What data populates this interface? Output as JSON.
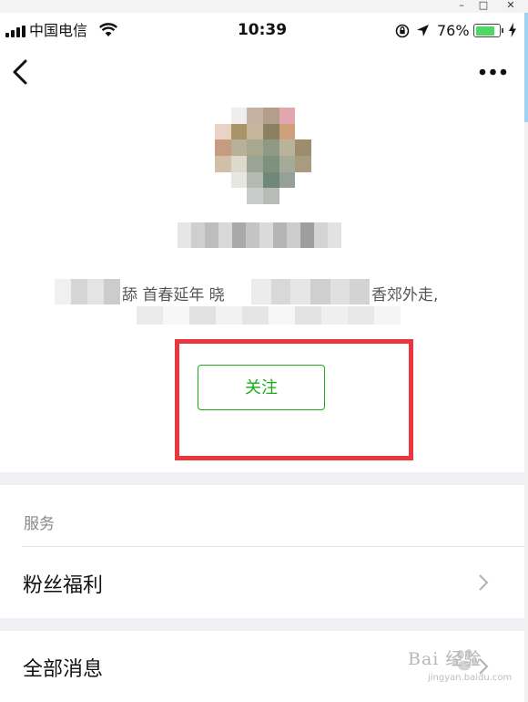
{
  "window": {
    "minimize": "–",
    "maximize": "□",
    "close": "✕"
  },
  "status_bar": {
    "carrier": "中国电信",
    "time": "10:39",
    "battery_percent": "76%",
    "battery_level": 0.76,
    "battery_color": "#4cd964"
  },
  "nav": {
    "back_icon": "chevron-left-icon",
    "more_icon": "more-dots-icon"
  },
  "profile": {
    "bio_visible_1": "舔   首春延年  晓",
    "bio_visible_2": "香郊外走,",
    "follow_label": "关注",
    "accent_color": "#1aad19",
    "highlight_color": "#e8383d"
  },
  "sections": {
    "services_label": "服务",
    "rows": [
      {
        "label": "粉丝福利"
      },
      {
        "label": "全部消息"
      }
    ]
  },
  "watermark": {
    "brand": "Bai 经验",
    "url": "jingyan.baidu.com"
  }
}
